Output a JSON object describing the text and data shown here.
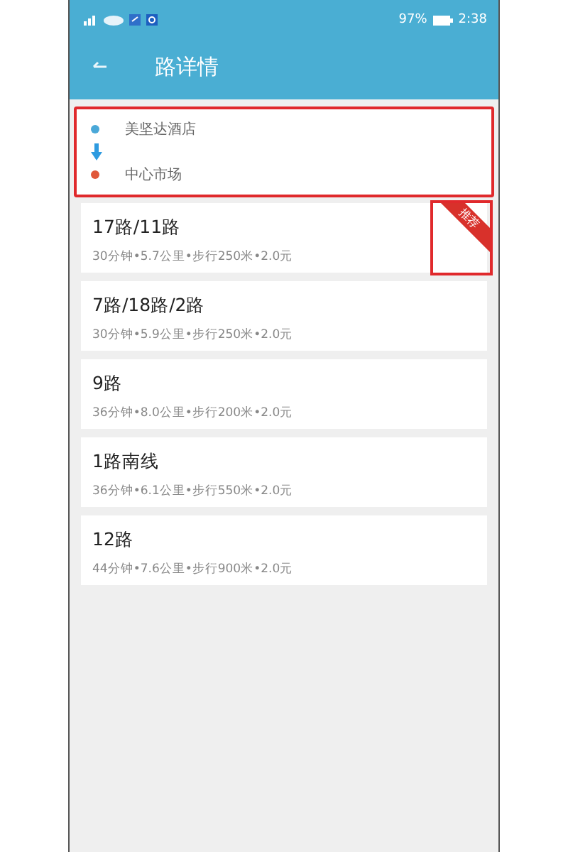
{
  "status_bar": {
    "battery": "97%",
    "time": "2:38"
  },
  "header": {
    "title": "路详情"
  },
  "trip": {
    "highlighted": true,
    "stops": [
      {
        "name": "美坚达酒店",
        "color": "#4aa8d8"
      },
      {
        "name": "中心市场",
        "color": "#e0583a"
      }
    ]
  },
  "routes": [
    {
      "name": "17路/11路",
      "info": "30分钟•5.7公里•步行250米•2.0元",
      "badge": "推荐",
      "highlighted": true
    },
    {
      "name": "7路/18路/2路",
      "info": "30分钟•5.9公里•步行250米•2.0元",
      "highlighted": false
    },
    {
      "name": "9路",
      "info": "36分钟•8.0公里•步行200米•2.0元",
      "highlighted": false
    },
    {
      "name": "1路南线",
      "info": "36分钟•6.1公里•步行550米•2.0元",
      "highlighted": false
    },
    {
      "name": "12路",
      "info": "44分钟•7.6公里•步行900米•2.0元",
      "highlighted": false
    }
  ]
}
